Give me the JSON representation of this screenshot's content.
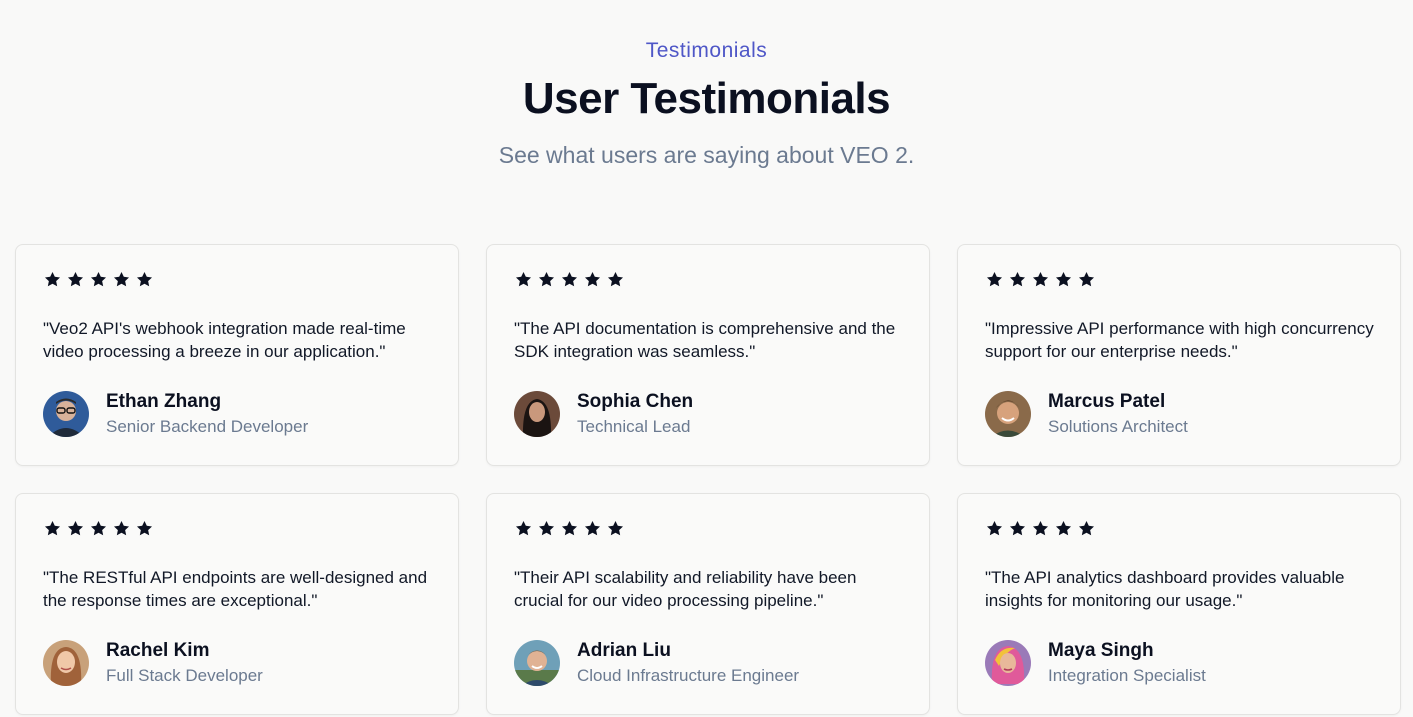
{
  "header": {
    "eyebrow": "Testimonials",
    "title": "User Testimonials",
    "subtitle": "See what users are saying about VEO 2."
  },
  "colors": {
    "accent": "#4f57c7",
    "star": "#0b1020",
    "muted": "#6b7a90"
  },
  "testimonials": [
    {
      "rating": 5,
      "quote": "\"Veo2 API's webhook integration made real-time video processing a breeze in our application.\"",
      "name": "Ethan Zhang",
      "role": "Senior Backend Developer",
      "avatar_icon": "avatar-man-glasses-icon"
    },
    {
      "rating": 5,
      "quote": "\"The API documentation is comprehensive and the SDK integration was seamless.\"",
      "name": "Sophia Chen",
      "role": "Technical Lead",
      "avatar_icon": "avatar-woman-dark-hair-icon"
    },
    {
      "rating": 5,
      "quote": "\"Impressive API performance with high concurrency support for our enterprise needs.\"",
      "name": "Marcus Patel",
      "role": "Solutions Architect",
      "avatar_icon": "avatar-man-smiling-icon"
    },
    {
      "rating": 5,
      "quote": "\"The RESTful API endpoints are well-designed and the response times are exceptional.\"",
      "name": "Rachel Kim",
      "role": "Full Stack Developer",
      "avatar_icon": "avatar-woman-light-hair-icon"
    },
    {
      "rating": 5,
      "quote": "\"Their API scalability and reliability have been crucial for our video processing pipeline.\"",
      "name": "Adrian Liu",
      "role": "Cloud Infrastructure Engineer",
      "avatar_icon": "avatar-man-outdoor-icon"
    },
    {
      "rating": 5,
      "quote": "\"The API analytics dashboard provides valuable insights for monitoring our usage.\"",
      "name": "Maya Singh",
      "role": "Integration Specialist",
      "avatar_icon": "avatar-woman-colorful-icon"
    }
  ]
}
